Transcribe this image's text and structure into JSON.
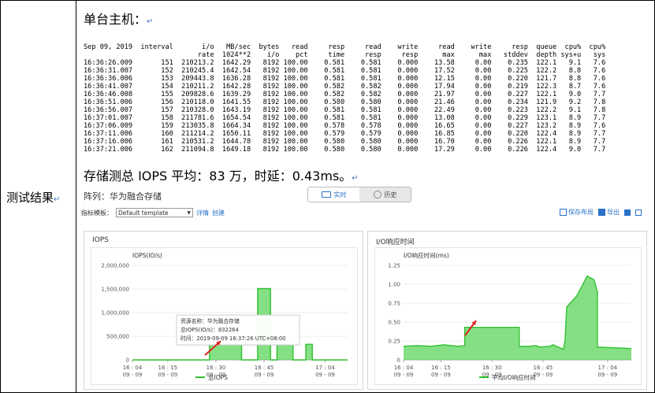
{
  "left_label": "测试结果",
  "return_mark": "↵",
  "heading_host": "单台主机：",
  "heading_storage": "存储测总 IOPS 平均：83 万，时延：0.43ms。",
  "terminal": {
    "header1": [
      "Sep 09, 2019",
      "interval",
      "i/o",
      "MB/sec",
      "bytes",
      "read",
      "resp",
      "read",
      "write",
      "read",
      "write",
      "resp",
      "queue",
      "cpu%",
      "cpu%"
    ],
    "header2": [
      "",
      "",
      "rate",
      "1024**2",
      "i/o",
      "pct",
      "time",
      "resp",
      "resp",
      "max",
      "max",
      "stddev",
      "depth",
      "sys+u",
      "sys"
    ],
    "rows": [
      [
        "16:36:26.009",
        "151",
        "210213.2",
        "1642.29",
        "8192",
        "100.00",
        "0.581",
        "0.581",
        "0.000",
        "13.58",
        "0.00",
        "0.235",
        "122.1",
        "9.1",
        "7.6"
      ],
      [
        "16:36:31.007",
        "152",
        "210245.4",
        "1642.54",
        "8192",
        "100.00",
        "0.581",
        "0.581",
        "0.000",
        "17.52",
        "0.00",
        "0.225",
        "122.2",
        "8.8",
        "7.6"
      ],
      [
        "16:36:36.006",
        "153",
        "209443.8",
        "1636.28",
        "8192",
        "100.00",
        "0.581",
        "0.581",
        "0.000",
        "12.15",
        "0.00",
        "0.220",
        "121.7",
        "8.8",
        "7.6"
      ],
      [
        "16:36:41.007",
        "154",
        "210211.2",
        "1642.28",
        "8192",
        "100.00",
        "0.582",
        "0.582",
        "0.000",
        "17.94",
        "0.00",
        "0.219",
        "122.3",
        "8.7",
        "7.6"
      ],
      [
        "16:36:46.008",
        "155",
        "209828.6",
        "1639.29",
        "8192",
        "100.00",
        "0.582",
        "0.582",
        "0.000",
        "21.97",
        "0.00",
        "0.227",
        "122.1",
        "9.0",
        "7.7"
      ],
      [
        "16:36:51.006",
        "156",
        "210118.0",
        "1641.55",
        "8192",
        "100.00",
        "0.580",
        "0.580",
        "0.000",
        "21.46",
        "0.00",
        "0.234",
        "121.9",
        "9.2",
        "7.8"
      ],
      [
        "16:36:56.007",
        "157",
        "210328.0",
        "1643.19",
        "8192",
        "100.00",
        "0.581",
        "0.581",
        "0.000",
        "22.49",
        "0.00",
        "0.223",
        "122.2",
        "9.1",
        "7.8"
      ],
      [
        "16:37:01.007",
        "158",
        "211781.6",
        "1654.54",
        "8192",
        "100.00",
        "0.581",
        "0.581",
        "0.000",
        "13.08",
        "0.00",
        "0.229",
        "123.1",
        "8.9",
        "7.7"
      ],
      [
        "16:37:06.009",
        "159",
        "213035.8",
        "1664.34",
        "8192",
        "100.00",
        "0.578",
        "0.578",
        "0.000",
        "16.65",
        "0.00",
        "0.227",
        "123.2",
        "8.9",
        "7.6"
      ],
      [
        "16:37:11.006",
        "160",
        "211214.2",
        "1650.11",
        "8192",
        "100.00",
        "0.579",
        "0.579",
        "0.000",
        "16.85",
        "0.00",
        "0.220",
        "122.4",
        "8.9",
        "7.7"
      ],
      [
        "16:37:16.006",
        "161",
        "210531.2",
        "1644.78",
        "8192",
        "100.00",
        "0.580",
        "0.580",
        "0.000",
        "16.70",
        "0.00",
        "0.226",
        "122.1",
        "8.9",
        "7.7"
      ],
      [
        "16:37:21.006",
        "162",
        "211094.8",
        "1649.18",
        "8192",
        "100.00",
        "0.580",
        "0.580",
        "0.000",
        "17.29",
        "0.00",
        "0.226",
        "122.4",
        "9.0",
        "7.7"
      ]
    ]
  },
  "console": {
    "array_label": "阵列：华为融合存储",
    "tab_realtime": "实时",
    "tab_history": "历史",
    "template_label": "指标模板：",
    "template_value": "Default template",
    "link_details": "详情",
    "link_create": "创建",
    "save_layout": "保存布局",
    "export": "导出",
    "accent": "#2a72c9",
    "series_color": "#5cd65c"
  },
  "chart_data": [
    {
      "type": "area",
      "title": "IOPS",
      "ylabel": "IOPS(IO/s)",
      "ylim": [
        0,
        2000000
      ],
      "yticks": [
        0,
        500000,
        1000000,
        1500000,
        2000000
      ],
      "ytick_labels": [
        "0",
        "500,000",
        "1,000,000",
        "1,500,000",
        "2,000,000"
      ],
      "xlim": [
        "16:04",
        "17:11"
      ],
      "xticks": [
        {
          "time": "16:04",
          "label": "16 : 04",
          "date": "09 - 09"
        },
        {
          "time": "16:15",
          "label": "16 : 15",
          "date": "09 - 09"
        },
        {
          "time": "16:30",
          "label": "16 : 30",
          "date": "09 - 09"
        },
        {
          "time": "16:45",
          "label": "16 : 45",
          "date": "09 - 09"
        },
        {
          "time": "17:04",
          "label": "17 : 04",
          "date": "09 - 09"
        }
      ],
      "series": [
        {
          "name": "总IOPS",
          "x": [
            "16:04",
            "16:28",
            "16:28",
            "16:38",
            "16:38",
            "16:43",
            "16:43",
            "16:47",
            "16:47",
            "16:49",
            "16:49",
            "16:54",
            "16:54",
            "16:58",
            "16:58",
            "17:00",
            "17:00",
            "17:11"
          ],
          "values": [
            0,
            0,
            330000,
            330000,
            0,
            0,
            1510000,
            1510000,
            0,
            0,
            330000,
            330000,
            0,
            0,
            330000,
            330000,
            0,
            0
          ]
        }
      ],
      "tooltip": {
        "line1": "资源名称：华为融合存储",
        "line2": "总IOPS(IO/s)：832264",
        "line3": "时间：2019-09-09 16:37:26 UTC+08:00"
      },
      "legend": "bottom"
    },
    {
      "type": "area",
      "title": "I/O响应时间",
      "ylabel": "I/O响应时间(ms)",
      "ylim": [
        0,
        1.25
      ],
      "yticks": [
        0,
        0.25,
        0.5,
        0.75,
        1.0,
        1.25
      ],
      "ytick_labels": [
        "0",
        "0.25",
        "0.50",
        "0.75",
        "1.00",
        "1.25"
      ],
      "xlim": [
        "16:04",
        "17:11"
      ],
      "xticks": [
        {
          "time": "16:04",
          "label": "16 : 04",
          "date": "09 - 09"
        },
        {
          "time": "16:15",
          "label": "16 : 15",
          "date": "09 - 09"
        },
        {
          "time": "16:30",
          "label": "16 : 30",
          "date": "09 - 09"
        },
        {
          "time": "16:45",
          "label": "16 : 45",
          "date": "09 - 09"
        },
        {
          "time": "17:04",
          "label": "17 : 04",
          "date": "09 - 09"
        }
      ],
      "series": [
        {
          "name": "平均I/O响应时间",
          "x": [
            "16:04",
            "16:08",
            "16:12",
            "16:16",
            "16:20",
            "16:22",
            "16:22",
            "16:37",
            "16:38",
            "16:38",
            "16:41",
            "16:43",
            "16:44",
            "16:47",
            "16:48",
            "16:51",
            "16:51.5",
            "16:52",
            "16:55",
            "16:58",
            "17:00",
            "17:01",
            "17:01",
            "17:11"
          ],
          "values": [
            0.18,
            0.19,
            0.18,
            0.2,
            0.18,
            0.19,
            0.43,
            0.43,
            0.43,
            0.18,
            0.18,
            0.19,
            0.17,
            0.18,
            0.2,
            0.14,
            0.25,
            0.7,
            0.85,
            1.11,
            1.06,
            0.9,
            0.17,
            0.15
          ]
        }
      ],
      "legend": "bottom"
    }
  ]
}
